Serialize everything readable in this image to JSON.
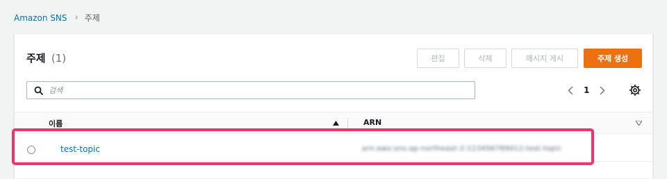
{
  "breadcrumb": {
    "root": "Amazon SNS",
    "current": "주제"
  },
  "panel": {
    "title": "주제",
    "count": "(1)"
  },
  "actions": {
    "edit": "편집",
    "delete": "삭제",
    "publish": "메시지 게시",
    "create": "주제 생성"
  },
  "search": {
    "placeholder": "검색",
    "value": ""
  },
  "pagination": {
    "page": "1"
  },
  "table": {
    "columns": [
      "이름",
      "ARN"
    ],
    "rows": [
      {
        "name": "test-topic",
        "arn": "arn:aws:sns:ap-northeast-2:123456789012:test-topic"
      }
    ]
  },
  "colors": {
    "link": "#0073bb",
    "primary": "#ec7211",
    "highlight": "#f0336b"
  }
}
